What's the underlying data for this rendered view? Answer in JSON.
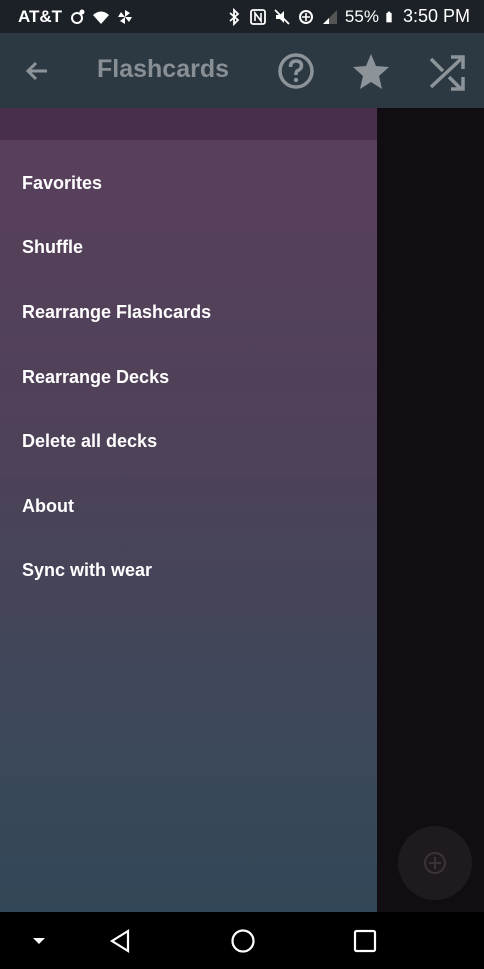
{
  "status_bar": {
    "carrier": "AT&T",
    "battery_percent": "55%",
    "time": "3:50 PM"
  },
  "app_bar": {
    "title": "Flashcards",
    "icons": [
      "back-arrow-icon",
      "help-circle-icon",
      "star-icon",
      "shuffle-icon"
    ]
  },
  "drawer": {
    "items": [
      {
        "label": "Favorites"
      },
      {
        "label": "Shuffle"
      },
      {
        "label": "Rearrange Flashcards"
      },
      {
        "label": "Rearrange Decks"
      },
      {
        "label": "Delete all decks"
      },
      {
        "label": "About"
      },
      {
        "label": "Sync with wear"
      }
    ]
  },
  "colors": {
    "app_bar": "#2d3942",
    "drawer_top": "#5a3f5c",
    "drawer_bottom": "#324757",
    "scrim": "#110d12"
  }
}
